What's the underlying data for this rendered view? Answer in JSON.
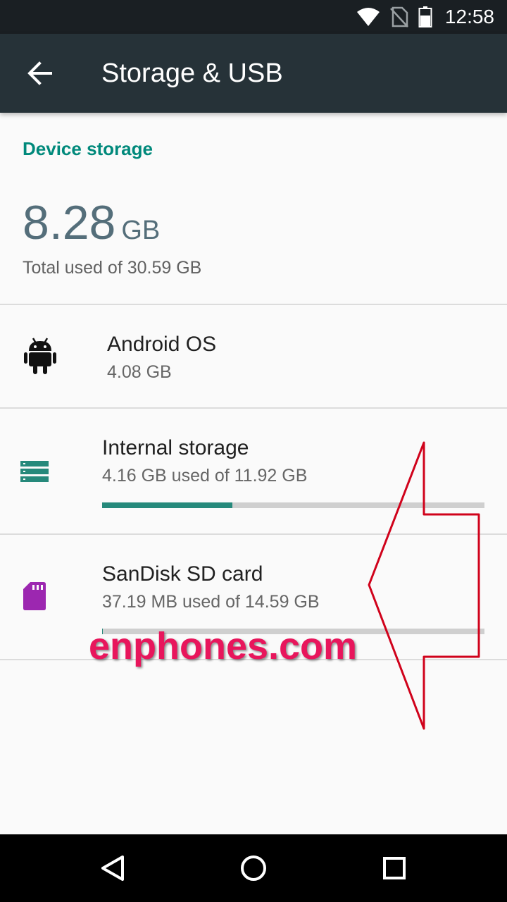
{
  "status_bar": {
    "time": "12:58",
    "icons": [
      "wifi-icon",
      "no-sim-icon",
      "battery-icon"
    ]
  },
  "toolbar": {
    "title": "Storage & USB",
    "back_icon": "arrow-back-icon"
  },
  "device_storage": {
    "header": "Device storage",
    "used_value": "8.28",
    "used_unit": "GB",
    "subtitle": "Total used of 30.59 GB"
  },
  "items": [
    {
      "icon": "android-icon",
      "title": "Android OS",
      "subtitle": "4.08 GB"
    },
    {
      "icon": "internal-storage-icon",
      "title": "Internal storage",
      "subtitle": "4.16 GB used of 11.92 GB",
      "usage_fraction": 0.34
    },
    {
      "icon": "sd-card-icon",
      "title": "SanDisk SD card",
      "subtitle": "37.19 MB used of 14.59 GB",
      "usage_fraction": 0.0025
    }
  ],
  "watermark": "enphones.com",
  "colors": {
    "accent": "#00897b",
    "toolbar": "#263238",
    "sd_card": "#9c27b0",
    "annotation_arrow": "#d0021b"
  },
  "nav_bar": [
    "back-nav-icon",
    "home-nav-icon",
    "recents-nav-icon"
  ]
}
